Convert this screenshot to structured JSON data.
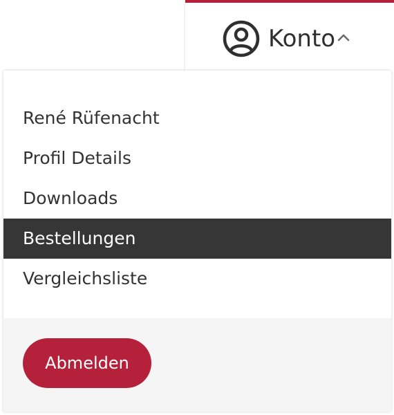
{
  "account": {
    "label": "Konto",
    "icon": "user-circle-icon",
    "expand_icon": "chevron-up-icon"
  },
  "menu": {
    "items": [
      {
        "label": "René Rüfenacht",
        "active": false
      },
      {
        "label": "Profil Details",
        "active": false
      },
      {
        "label": "Downloads",
        "active": false
      },
      {
        "label": "Bestellungen",
        "active": true
      },
      {
        "label": "Vergleichsliste",
        "active": false
      }
    ]
  },
  "footer": {
    "logout_label": "Abmelden"
  },
  "colors": {
    "accent": "#b5213a",
    "active_bg": "#363636",
    "footer_bg": "#f5f5f5",
    "text": "#333333"
  }
}
